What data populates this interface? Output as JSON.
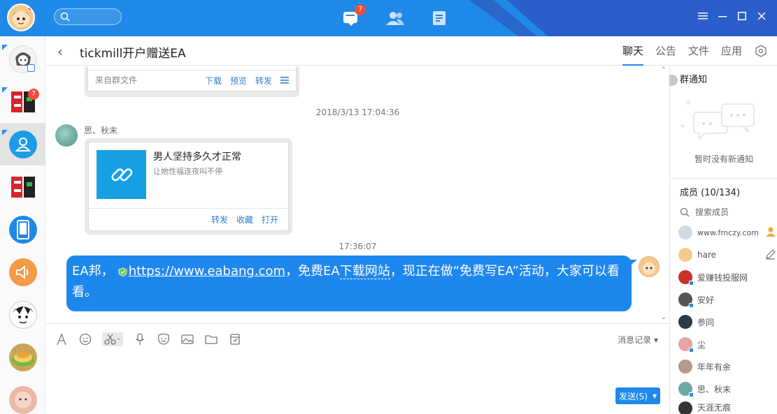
{
  "topbar": {
    "notify_badge": "7",
    "icons": [
      "messages-icon",
      "contacts-icon",
      "docs-icon"
    ]
  },
  "sidebar": {
    "items": [
      {
        "name": "chat-1",
        "badge": ""
      },
      {
        "name": "chat-ea-group",
        "badge": "7"
      },
      {
        "name": "chat-contacts",
        "badge": ""
      },
      {
        "name": "chat-ea-2",
        "badge": ""
      },
      {
        "name": "chat-phone",
        "badge": ""
      },
      {
        "name": "chat-speaker",
        "badge": ""
      },
      {
        "name": "chat-anime",
        "badge": ""
      },
      {
        "name": "chat-food",
        "badge": ""
      },
      {
        "name": "chat-baby",
        "badge": ""
      }
    ]
  },
  "header": {
    "title": "tickmill开户赠送EA",
    "tabs": [
      "聊天",
      "公告",
      "文件",
      "应用"
    ]
  },
  "messages": {
    "file_card": {
      "source": "来自群文件",
      "actions": [
        "下载",
        "预览",
        "转发"
      ]
    },
    "time1": "2018/3/13 17:04:36",
    "sender": "思、秋末",
    "link_card": {
      "title": "男人坚持多久才正常",
      "desc": "让她性福连夜叫不停",
      "actions": [
        "转发",
        "收藏",
        "打开"
      ]
    },
    "time2": "17:36:07",
    "my_message": {
      "part1": "EA邦，",
      "url": "https://www.eabang.com",
      "part2": "，免费EA",
      "dashed": "下载网站",
      "part3": "，现正在做“免费写EA”活动，大家可以看看。"
    }
  },
  "input": {
    "history_label": "消息记录",
    "send_label": "发送(S)"
  },
  "right_panel": {
    "notice_title": "群通知",
    "notice_empty": "暂时没有新通知",
    "members_title": "成员 (10/134)",
    "search_label": "搜索成员",
    "members": [
      "www.fmczy.com",
      "hare",
      "爱赚钱投服网",
      "安好",
      "参同",
      "尘",
      "年年有余",
      "思、秋末",
      "天涯无痕"
    ]
  },
  "colors": {
    "brand": "#1e89e8",
    "bubble": "#1e87ee",
    "link": "#2d7fd3",
    "badge": "#f24c3c"
  }
}
